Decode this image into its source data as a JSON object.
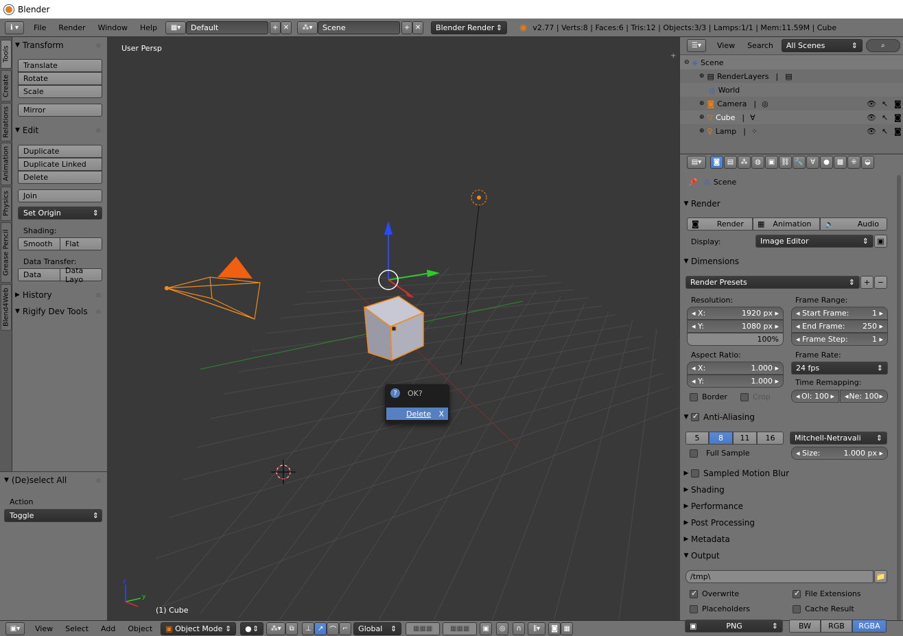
{
  "window": {
    "title": "Blender"
  },
  "info_header": {
    "menus": [
      "File",
      "Render",
      "Window",
      "Help"
    ],
    "layout": "Default",
    "scene": "Scene",
    "engine": "Blender Render",
    "stats": "v2.77 | Verts:8 | Faces:6 | Tris:12 | Objects:3/3 | Lamps:1/1 | Mem:11.59M | Cube"
  },
  "left_tabs": [
    "Tools",
    "Create",
    "Relations",
    "Animation",
    "Physics",
    "Grease Pencil",
    "Blend4Web"
  ],
  "tool_shelf": {
    "transform": {
      "title": "Transform",
      "buttons": [
        "Translate",
        "Rotate",
        "Scale"
      ],
      "mirror": "Mirror"
    },
    "edit": {
      "title": "Edit",
      "buttons": [
        "Duplicate",
        "Duplicate Linked",
        "Delete"
      ],
      "join": "Join",
      "set_origin": "Set Origin",
      "shading_label": "Shading:",
      "smooth": "Smooth",
      "flat": "Flat",
      "transfer_label": "Data Transfer:",
      "data": "Data",
      "data_layo": "Data Layo"
    },
    "history": "History",
    "rigify": "Rigify Dev Tools",
    "operator": {
      "title": "(De)select All",
      "action_label": "Action",
      "action_value": "Toggle"
    }
  },
  "viewport": {
    "view_label": "User Persp",
    "object_label": "(1) Cube"
  },
  "dialog": {
    "title": "OK?",
    "action": "Delete",
    "shortcut": "X"
  },
  "outliner": {
    "menus": [
      "View",
      "Search"
    ],
    "filter": "All Scenes",
    "items": [
      {
        "name": "Scene",
        "level": 0
      },
      {
        "name": "RenderLayers",
        "level": 1
      },
      {
        "name": "World",
        "level": 1
      },
      {
        "name": "Camera",
        "level": 1
      },
      {
        "name": "Cube",
        "level": 1
      },
      {
        "name": "Lamp",
        "level": 1
      }
    ]
  },
  "properties": {
    "context": "Scene",
    "render": {
      "title": "Render",
      "buttons": [
        "Render",
        "Animation",
        "Audio"
      ],
      "display_label": "Display:",
      "display_value": "Image Editor"
    },
    "dimensions": {
      "title": "Dimensions",
      "presets": "Render Presets",
      "resolution_label": "Resolution:",
      "res_x": "X:",
      "res_x_val": "1920 px",
      "res_y": "Y:",
      "res_y_val": "1080 px",
      "res_pct": "100%",
      "frame_range_label": "Frame Range:",
      "start": "Start Frame:",
      "start_val": "1",
      "end": "End Frame:",
      "end_val": "250",
      "step": "Frame Step:",
      "step_val": "1",
      "aspect_label": "Aspect Ratio:",
      "asp_x": "X:",
      "asp_x_val": "1.000",
      "asp_y": "Y:",
      "asp_y_val": "1.000",
      "frame_rate_label": "Frame Rate:",
      "frame_rate": "24 fps",
      "remap_label": "Time Remapping:",
      "remap_old": "Ol: 100",
      "remap_new": "Ne: 100",
      "border": "Border",
      "crop": "Crop"
    },
    "anti_aliasing": {
      "title": "Anti-Aliasing",
      "samples": [
        "5",
        "8",
        "11",
        "16"
      ],
      "selected": "8",
      "filter": "Mitchell-Netravali",
      "full_sample": "Full Sample",
      "size_label": "Size:",
      "size_val": "1.000 px"
    },
    "collapsed": [
      "Sampled Motion Blur",
      "Shading",
      "Performance",
      "Post Processing",
      "Metadata"
    ],
    "output": {
      "title": "Output",
      "path": "/tmp\\",
      "overwrite": "Overwrite",
      "file_ext": "File Extensions",
      "placeholders": "Placeholders",
      "cache": "Cache Result",
      "format": "PNG",
      "bw": "BW",
      "rgb": "RGB",
      "rgba": "RGBA"
    }
  },
  "bottom_header": {
    "menus": [
      "View",
      "Select",
      "Add",
      "Object"
    ],
    "mode": "Object Mode",
    "orientation": "Global"
  },
  "colors": {
    "accent": "#5680c2",
    "object_select": "#f08a1e",
    "viewport": "#393939",
    "panel": "#727272"
  }
}
